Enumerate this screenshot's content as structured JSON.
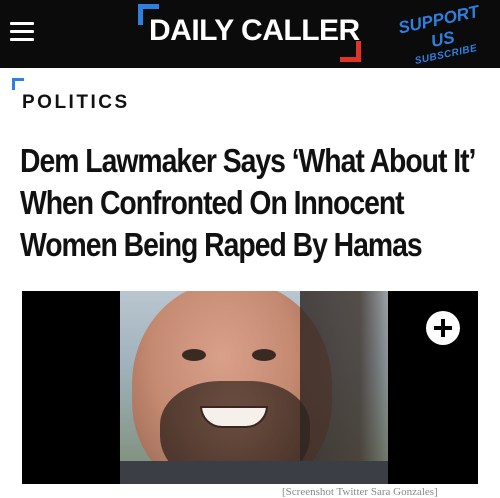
{
  "header": {
    "menu_icon": "hamburger-menu-icon",
    "logo_text": "DAILY CALLER",
    "support_label": "SUPPORT US",
    "subscribe_label": "SUBSCRIBE",
    "colors": {
      "bar": "#0b0b0b",
      "accent_blue": "#2f7fe0",
      "accent_red": "#e0342b"
    }
  },
  "article": {
    "section": "POLITICS",
    "headline": "Dem Lawmaker Says ‘What About It’ When Confronted On Innocent Women Being Raped By Hamas",
    "media": {
      "expand_icon": "plus-icon",
      "caption": "[Screenshot Twitter Sara Gonzales]"
    }
  }
}
